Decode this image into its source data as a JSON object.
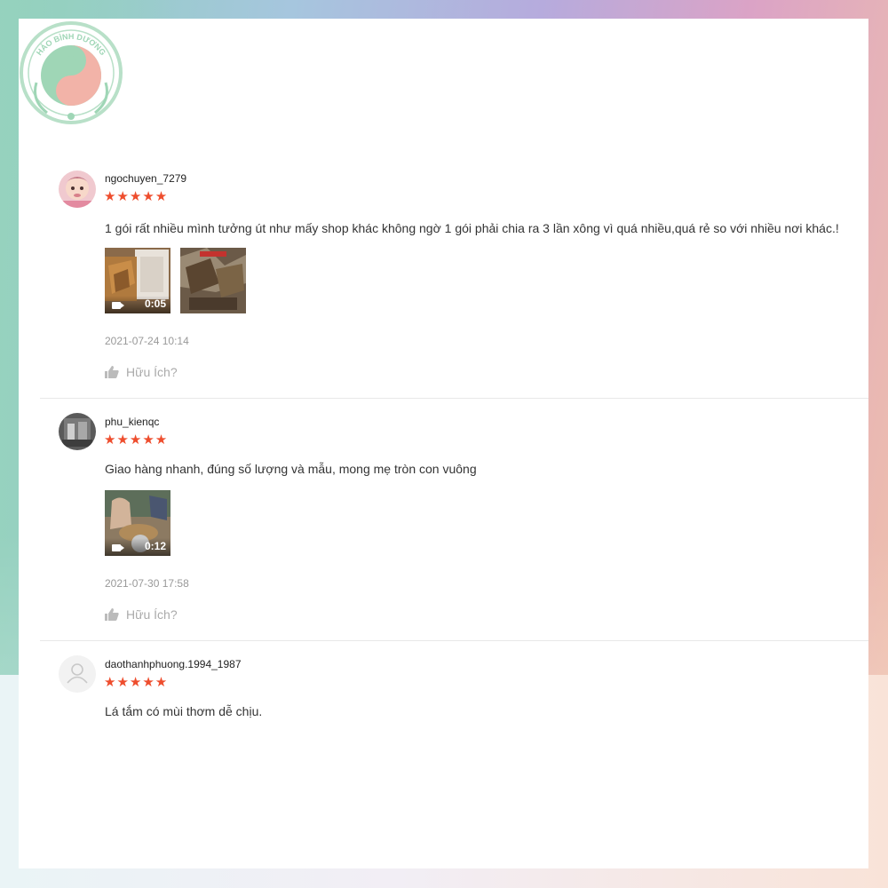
{
  "brand": {
    "logo_text": "HẢO BÌNH DƯƠNG"
  },
  "colors": {
    "star": "#ee4d2d",
    "muted": "#999999",
    "text": "#333333"
  },
  "reviews": [
    {
      "username": "ngochuyen_7279",
      "rating": 5,
      "stars": "★★★★★",
      "comment": "1 gói rất nhiều mình tưởng út như mấy shop khác không ngờ 1 gói phải chia ra 3 lần xông vì quá nhiều,quá rẻ so với nhiều nơi khác.!",
      "media": [
        {
          "type": "video",
          "duration": "0:05"
        },
        {
          "type": "image"
        }
      ],
      "timestamp": "2021-07-24 10:14",
      "helpful_label": "Hữu Ích?"
    },
    {
      "username": "phu_kienqc",
      "rating": 5,
      "stars": "★★★★★",
      "comment": "Giao hàng nhanh, đúng số lượng và mẫu, mong mẹ tròn con vuông",
      "media": [
        {
          "type": "video",
          "duration": "0:12"
        }
      ],
      "timestamp": "2021-07-30 17:58",
      "helpful_label": "Hữu Ích?"
    },
    {
      "username": "daothanhphuong.1994_1987",
      "rating": 5,
      "stars": "★★★★★",
      "comment": "Lá tắm có mùi thơm dễ chịu."
    }
  ]
}
